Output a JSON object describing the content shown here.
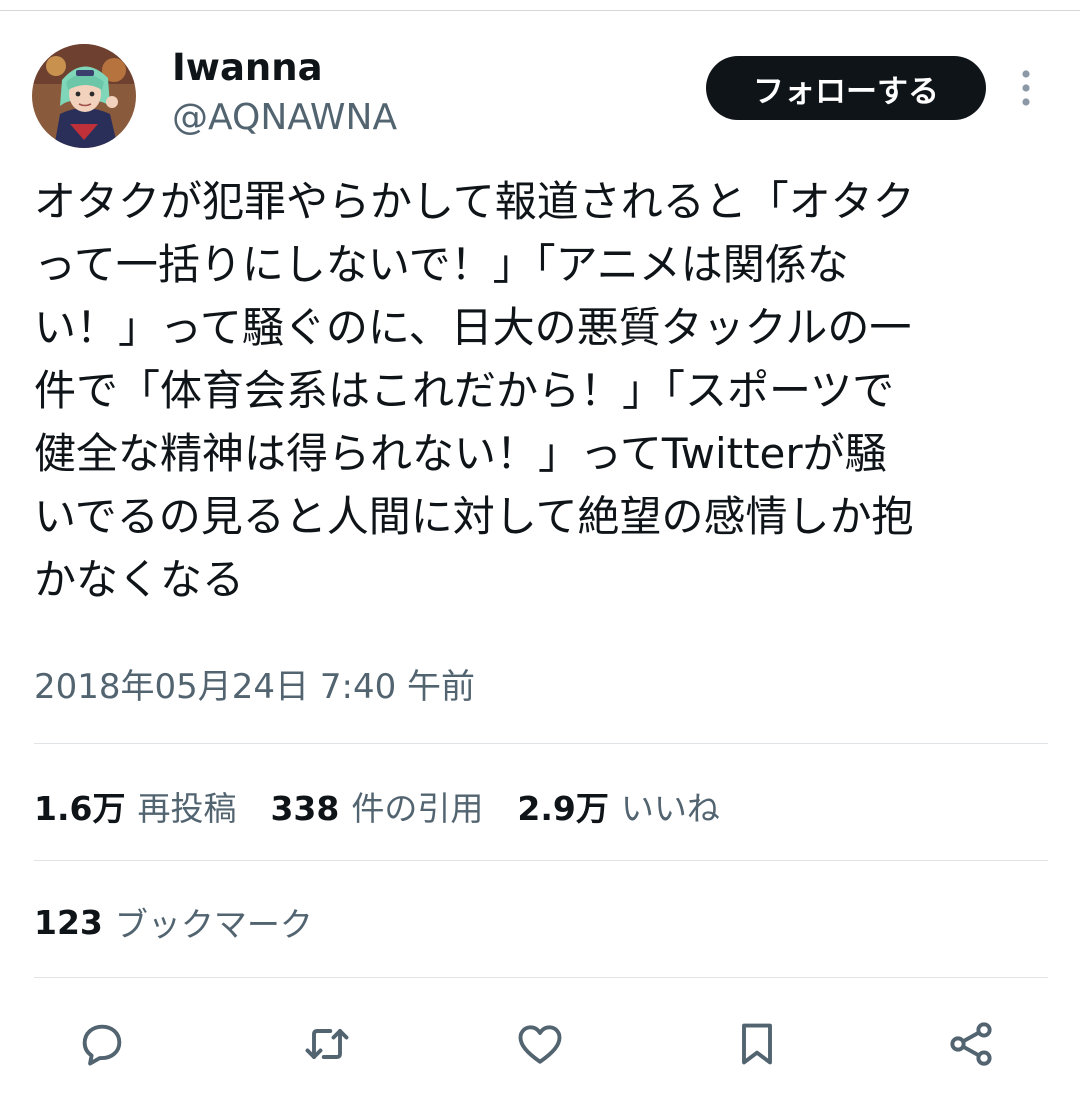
{
  "author": {
    "display_name": "Iwanna",
    "handle": "@AQNAWNA"
  },
  "follow_button_label": "フォローする",
  "tweet": {
    "text": "オタクが犯罪やらかして報道されると「オタク\nって一括りにしないで！」「アニメは関係な\nい！」って騒ぐのに、日大の悪質タックルの一\n件で「体育会系はこれだから！」「スポーツで\n健全な精神は得られない！」ってTwitterが騒\nいでるの見ると人間に対して絶望の感情しか抱\nかなくなる",
    "timestamp": "2018年05月24日 7:40 午前"
  },
  "stats": {
    "retweets_count": "1.6万",
    "retweets_label": "再投稿",
    "quotes_count": "338",
    "quotes_label": "件の引用",
    "likes_count": "2.9万",
    "likes_label": "いいね",
    "bookmarks_count": "123",
    "bookmarks_label": "ブックマーク"
  },
  "icons": {
    "more": "more-vertical-icon",
    "reply": "reply-icon",
    "retweet": "retweet-icon",
    "like": "heart-icon",
    "bookmark": "bookmark-icon",
    "share": "share-icon"
  },
  "colors": {
    "text_primary": "#0f1419",
    "text_secondary": "#536471",
    "button_bg": "#0f1419",
    "divider": "#e1e4e6"
  }
}
